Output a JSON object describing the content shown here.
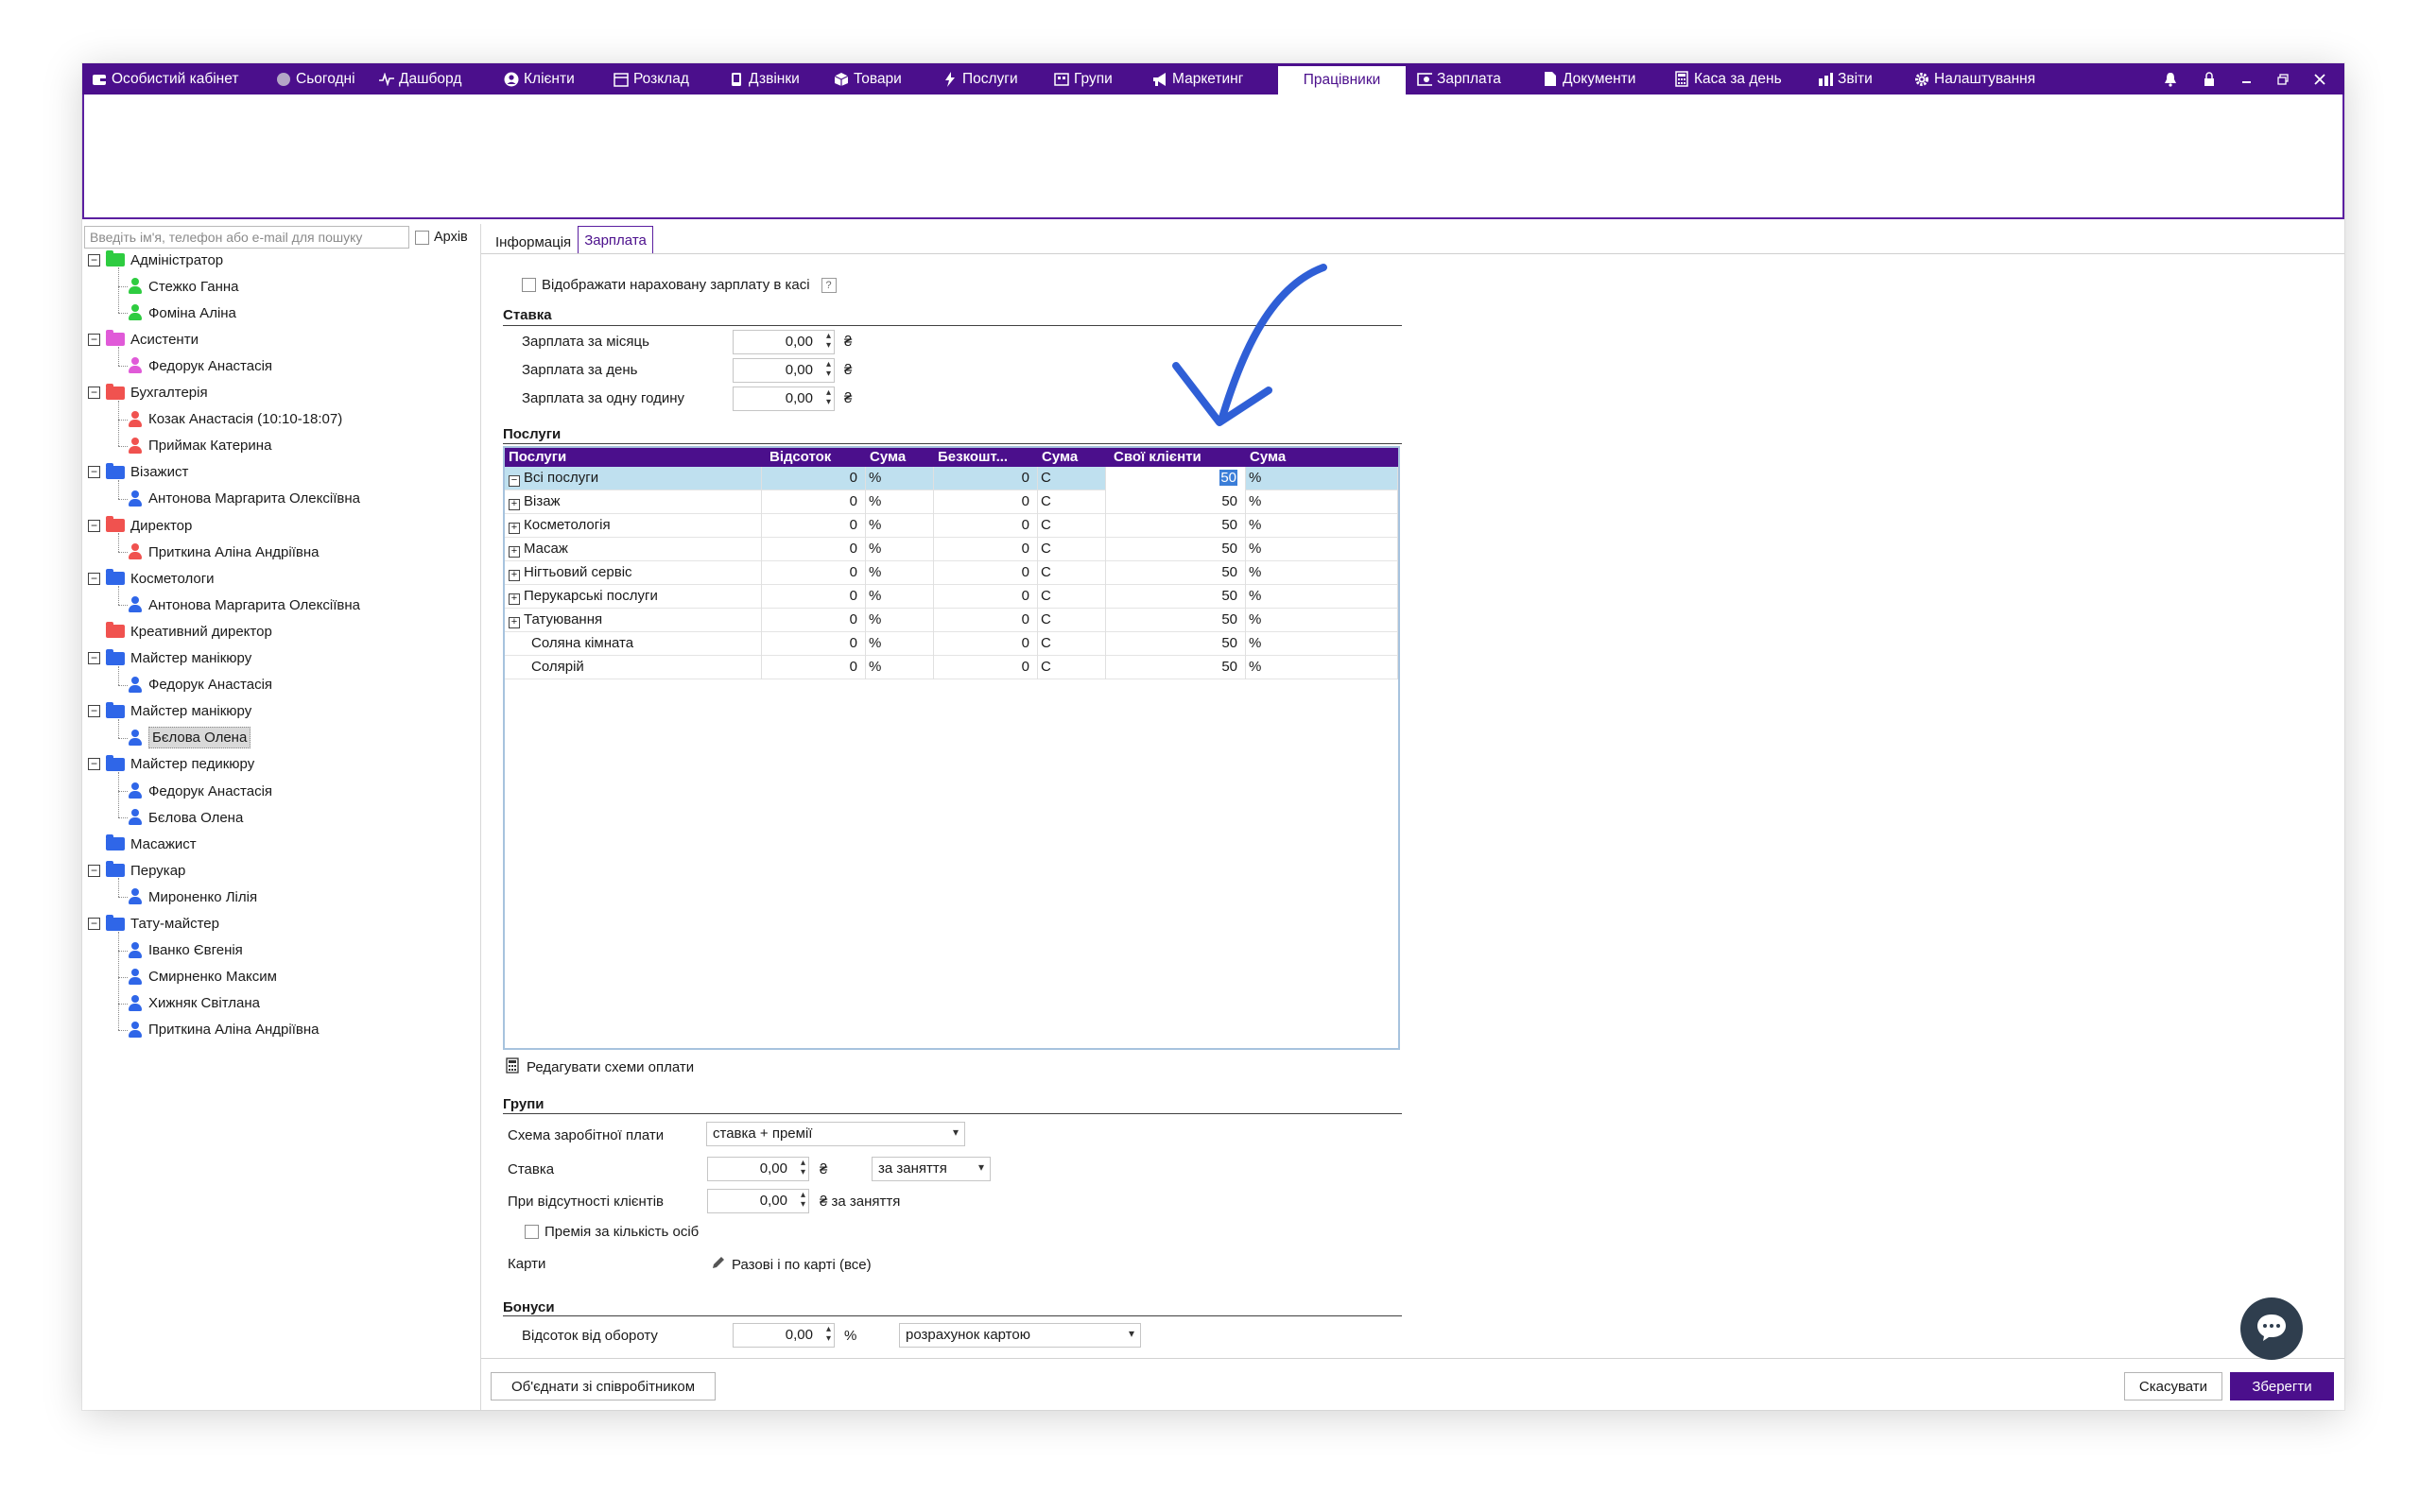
{
  "nav": {
    "items": [
      {
        "label": "Особистий кабінет",
        "icon": "wallet-icon"
      },
      {
        "label": "Сьогодні",
        "icon": "clock-icon"
      },
      {
        "label": "Дашборд",
        "icon": "pulse-icon"
      },
      {
        "label": "Клієнти",
        "icon": "user-circle-icon"
      },
      {
        "label": "Розклад",
        "icon": "calendar-icon"
      },
      {
        "label": "Дзвінки",
        "icon": "phone-icon"
      },
      {
        "label": "Товари",
        "icon": "box-icon"
      },
      {
        "label": "Послуги",
        "icon": "lightning-icon"
      },
      {
        "label": "Групи",
        "icon": "group-icon"
      },
      {
        "label": "Маркетинг",
        "icon": "megaphone-icon"
      },
      {
        "label": "Працівники",
        "icon": ""
      },
      {
        "label": "Зарплата",
        "icon": "money-icon"
      },
      {
        "label": "Документи",
        "icon": "document-icon"
      },
      {
        "label": "Каса за день",
        "icon": "calculator-icon"
      },
      {
        "label": "Звіти",
        "icon": "bar-chart-icon"
      },
      {
        "label": "Налаштування",
        "icon": "gear-icon"
      }
    ],
    "active": "Працівники"
  },
  "left": {
    "search_placeholder": "Введіть ім'я, телефон або e-mail для пошуку",
    "archive_label": "Архів",
    "tree": [
      {
        "label": "Адміністратор",
        "color": "#2ecc40",
        "children": [
          "Стежко Ганна",
          "Фоміна Аліна"
        ]
      },
      {
        "label": "Асистенти",
        "color": "#e05ad8",
        "children": [
          "Федорук Анастасія"
        ]
      },
      {
        "label": "Бухгалтерія",
        "color": "#f0524f",
        "children": [
          "Козак Анастасія (10:10-18:07)",
          "Приймак Катерина"
        ]
      },
      {
        "label": "Візажист",
        "color": "#2f66e8",
        "children": [
          "Антонова Маргарита Олексіївна"
        ]
      },
      {
        "label": "Директор",
        "color": "#f0524f",
        "children": [
          "Приткина Аліна Андріївна"
        ]
      },
      {
        "label": "Косметологи",
        "color": "#2f66e8",
        "children": [
          "Антонова Маргарита Олексіївна"
        ]
      },
      {
        "label": "Креативний директор",
        "color": "#f0524f",
        "children": []
      },
      {
        "label": "Майстер манікюру",
        "color": "#2f66e8",
        "children": [
          "Федорук Анастасія"
        ]
      },
      {
        "label": "Майстер манікюру",
        "color": "#2f66e8",
        "children": [
          "Бєлова Олена"
        ]
      },
      {
        "label": "Майстер педикюру",
        "color": "#2f66e8",
        "children": [
          "Федорук Анастасія",
          "Бєлова Олена"
        ]
      },
      {
        "label": "Масажист",
        "color": "#2f66e8",
        "children": []
      },
      {
        "label": "Перукар",
        "color": "#2f66e8",
        "children": [
          "Мироненко Лілія"
        ]
      },
      {
        "label": "Тату-майстер",
        "color": "#2f66e8",
        "children": [
          "Іванко Євгенія",
          "Смирненко Максим",
          "Хижняк Світлана",
          "Приткина Аліна Андріївна"
        ]
      }
    ]
  },
  "tabs": {
    "info": "Інформація",
    "salary": "Зарплата"
  },
  "salary": {
    "show_in_cash_label": "Відображати нараховану зарплату в касі",
    "help_label": "?",
    "rate_title": "Ставка",
    "rates": [
      {
        "label": "Зарплата за місяць",
        "value": "0,00",
        "unit": "₴"
      },
      {
        "label": "Зарплата за день",
        "value": "0,00",
        "unit": "₴"
      },
      {
        "label": "Зарплата за одну годину",
        "value": "0,00",
        "unit": "₴"
      }
    ],
    "services_title": "Послуги",
    "grid_headers": [
      "Послуги",
      "Відсоток",
      "Сума",
      "Безкошт...",
      "Сума",
      "Свої клієнти",
      "Сума"
    ],
    "grid_rows": [
      {
        "name": "Всі послуги",
        "expander": "−",
        "pct": "0",
        "pct_unit": "%",
        "free": "0",
        "free_unit": "С",
        "own": "50",
        "own_unit": "%"
      },
      {
        "name": "Візаж",
        "expander": "+",
        "pct": "0",
        "pct_unit": "%",
        "free": "0",
        "free_unit": "С",
        "own": "50",
        "own_unit": "%"
      },
      {
        "name": "Косметологія",
        "expander": "+",
        "pct": "0",
        "pct_unit": "%",
        "free": "0",
        "free_unit": "С",
        "own": "50",
        "own_unit": "%"
      },
      {
        "name": "Масаж",
        "expander": "+",
        "pct": "0",
        "pct_unit": "%",
        "free": "0",
        "free_unit": "С",
        "own": "50",
        "own_unit": "%"
      },
      {
        "name": "Нігтьовий сервіс",
        "expander": "+",
        "pct": "0",
        "pct_unit": "%",
        "free": "0",
        "free_unit": "С",
        "own": "50",
        "own_unit": "%"
      },
      {
        "name": "Перукарські послуги",
        "expander": "+",
        "pct": "0",
        "pct_unit": "%",
        "free": "0",
        "free_unit": "С",
        "own": "50",
        "own_unit": "%"
      },
      {
        "name": "Татуювання",
        "expander": "+",
        "pct": "0",
        "pct_unit": "%",
        "free": "0",
        "free_unit": "С",
        "own": "50",
        "own_unit": "%"
      },
      {
        "name": "Соляна кімната",
        "expander": "",
        "pct": "0",
        "pct_unit": "%",
        "free": "0",
        "free_unit": "С",
        "own": "50",
        "own_unit": "%"
      },
      {
        "name": "Солярій",
        "expander": "",
        "pct": "0",
        "pct_unit": "%",
        "free": "0",
        "free_unit": "С",
        "own": "50",
        "own_unit": "%"
      }
    ],
    "edit_schemes_label": "Редагувати схеми оплати",
    "groups_title": "Групи",
    "scheme_label": "Схема заробітної плати",
    "scheme_value": "ставка + премії",
    "group_rate_label": "Ставка",
    "group_rate_value": "0,00",
    "group_rate_unit": "₴",
    "group_rate_period": "за заняття",
    "absence_label": "При відсутності клієнтів",
    "absence_value": "0,00",
    "absence_unit": "₴ за заняття",
    "bonus_per_person_label": "Премія за кількість осіб",
    "cards_label": "Карти",
    "cards_value": "Разові і по карті (все)",
    "bonuses_title": "Бонуси",
    "turnover_label": "Відсоток від обороту",
    "turnover_value": "0,00",
    "turnover_unit": "%",
    "turnover_mode": "розрахунок картою"
  },
  "footer": {
    "merge_label": "Об'єднати зі співробітником",
    "cancel_label": "Скасувати",
    "save_label": "Зберегти"
  }
}
